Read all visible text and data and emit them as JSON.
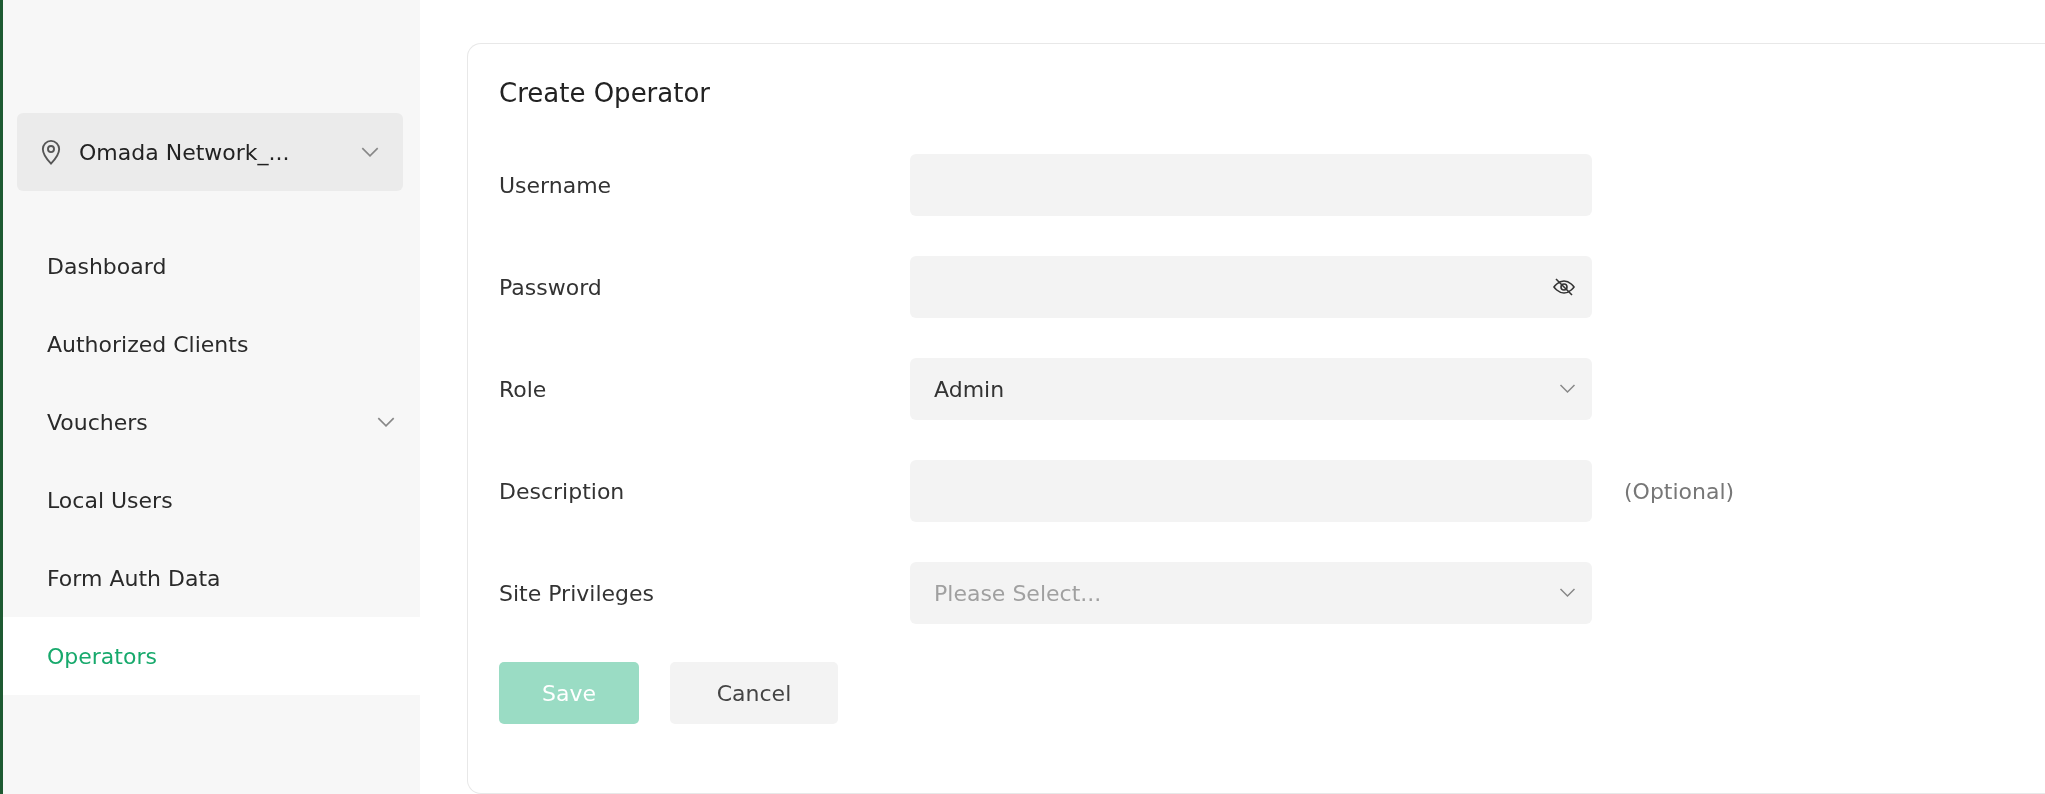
{
  "site_selector": {
    "label": "Omada Network_..."
  },
  "sidebar": {
    "items": [
      {
        "label": "Dashboard",
        "selected": false,
        "has_submenu": false
      },
      {
        "label": "Authorized Clients",
        "selected": false,
        "has_submenu": false
      },
      {
        "label": "Vouchers",
        "selected": false,
        "has_submenu": true
      },
      {
        "label": "Local Users",
        "selected": false,
        "has_submenu": false
      },
      {
        "label": "Form Auth Data",
        "selected": false,
        "has_submenu": false
      },
      {
        "label": "Operators",
        "selected": true,
        "has_submenu": false
      }
    ]
  },
  "form": {
    "title": "Create Operator",
    "fields": [
      {
        "label": "Username",
        "kind": "text"
      },
      {
        "label": "Password",
        "kind": "password"
      },
      {
        "label": "Role",
        "kind": "select",
        "value": "Admin"
      },
      {
        "label": "Description",
        "kind": "text",
        "note": "(Optional)"
      },
      {
        "label": "Site Privileges",
        "kind": "select",
        "placeholder": "Please Select..."
      }
    ],
    "buttons": [
      {
        "label": "Save",
        "kind": "primary",
        "disabled": true
      },
      {
        "label": "Cancel",
        "kind": "secondary",
        "disabled": false
      }
    ]
  }
}
